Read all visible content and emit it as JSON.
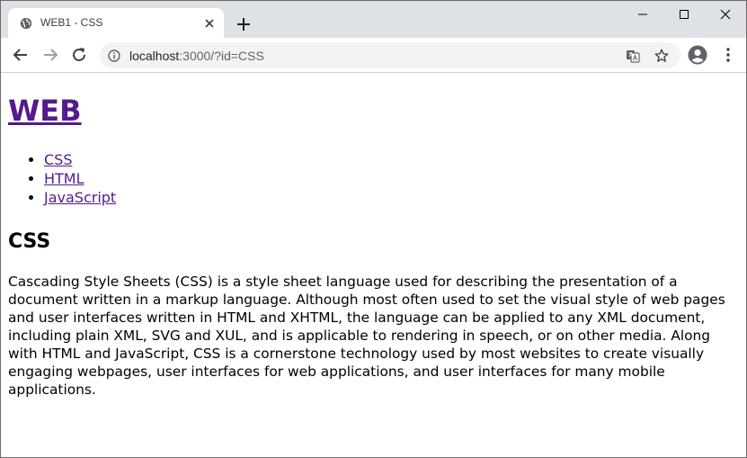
{
  "browser": {
    "tab": {
      "title": "WEB1 - CSS"
    },
    "address_bar": {
      "host": "localhost",
      "path": ":3000/?id=CSS"
    },
    "accent": "#dee1e6"
  },
  "page": {
    "heading": "WEB",
    "nav": [
      {
        "label": "CSS"
      },
      {
        "label": "HTML"
      },
      {
        "label": "JavaScript"
      }
    ],
    "section_title": "CSS",
    "body": "Cascading Style Sheets (CSS) is a style sheet language used for describing the presentation of a document written in a markup language. Although most often used to set the visual style of web pages and user interfaces written in HTML and XHTML, the language can be applied to any XML document, including plain XML, SVG and XUL, and is applicable to rendering in speech, or on other media. Along with HTML and JavaScript, CSS is a cornerstone technology used by most websites to create visually engaging webpages, user interfaces for web applications, and user interfaces for many mobile applications.",
    "link_color": "#551a8b"
  }
}
